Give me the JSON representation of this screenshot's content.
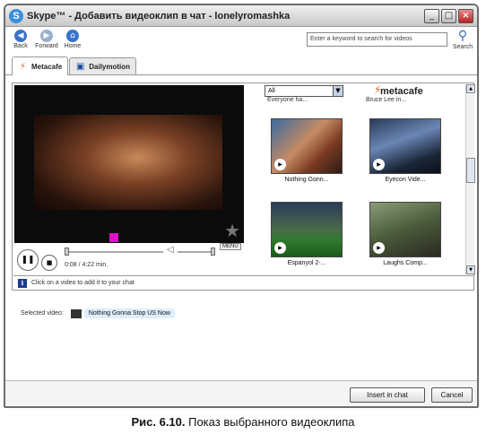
{
  "window": {
    "title": "Skype™ - Добавить видеоклип в чат - lonelyromashka"
  },
  "toolbar": {
    "back_label": "Back",
    "forward_label": "Forward",
    "home_label": "Home",
    "search_placeholder": "Enter a keyword to search for videos",
    "search_label": "Search"
  },
  "tabs": [
    {
      "label": "Metacafe"
    },
    {
      "label": "Dailymotion"
    }
  ],
  "player": {
    "time": "0:08 / 4:22 min.",
    "menu_label": "MENU"
  },
  "results": {
    "category": "All",
    "brand": "metacafe",
    "cut_labels": [
      "Everyone ha...",
      "Bruce Lee in..."
    ],
    "items": [
      {
        "title": "Nothing Gonn..."
      },
      {
        "title": "Eyecon Vide..."
      },
      {
        "title": "Espanyol 2-..."
      },
      {
        "title": "Laughs Comp..."
      }
    ]
  },
  "hint": {
    "text": "Click on a video to add it to your chat"
  },
  "selected": {
    "label": "Selected video:",
    "title": "Nothing Gonna Stop US Now"
  },
  "footer": {
    "insert_label": "Insert in chat",
    "cancel_label": "Cancel"
  },
  "caption": {
    "number": "Рис. 6.10.",
    "text": " Показ выбранного видеоклипа"
  },
  "colors": {
    "accent": "#3a8fd8",
    "brand_orange": "#e05a1a",
    "marker_pink": "#e010c8"
  }
}
